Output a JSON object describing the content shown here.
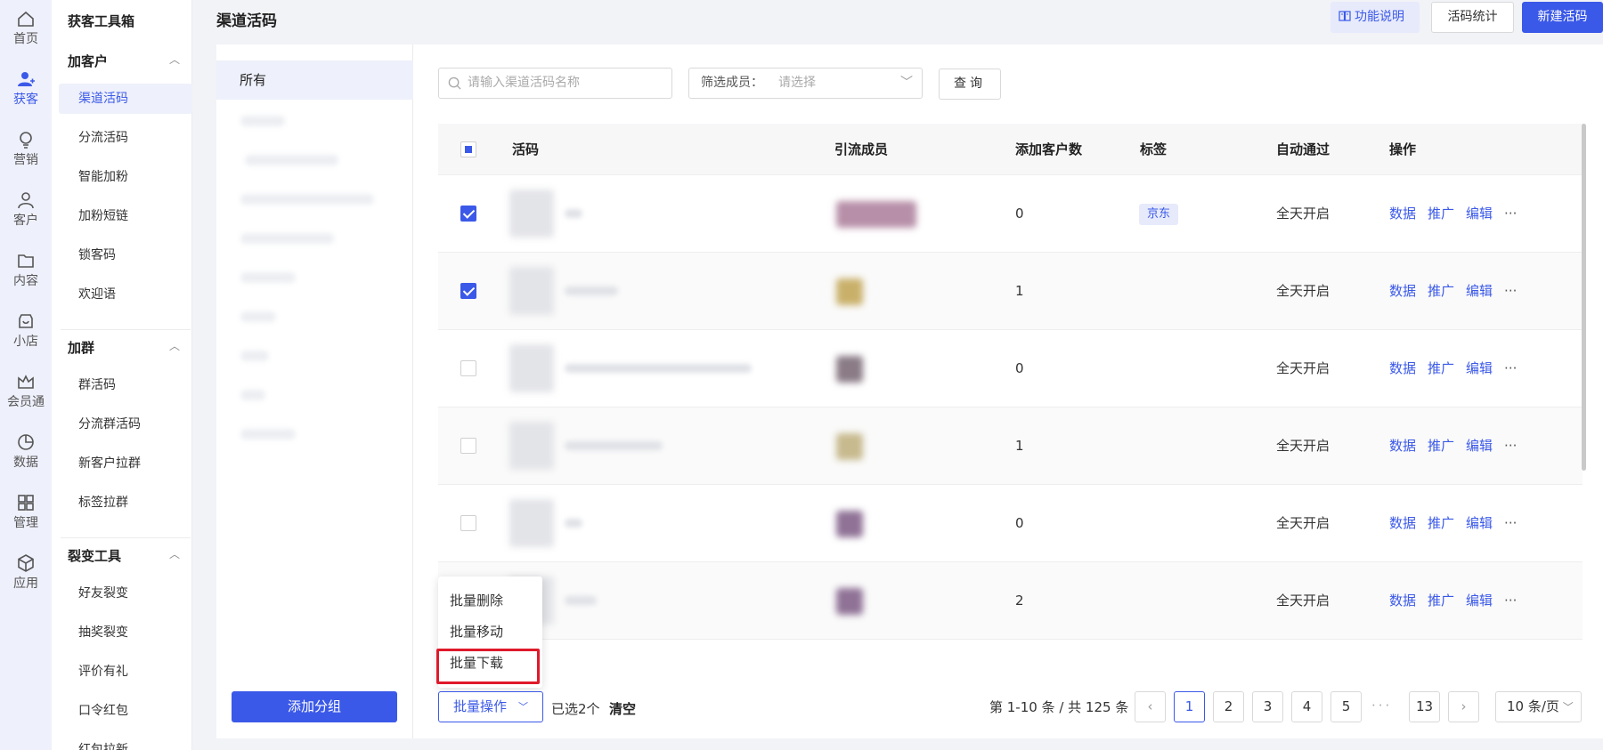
{
  "rail": [
    {
      "label": "首页",
      "icon": "home-icon"
    },
    {
      "label": "获客",
      "icon": "user-plus-icon",
      "active": true
    },
    {
      "label": "营销",
      "icon": "bulb-icon"
    },
    {
      "label": "客户",
      "icon": "user-icon"
    },
    {
      "label": "内容",
      "icon": "folder-icon"
    },
    {
      "label": "小店",
      "icon": "shop-icon"
    },
    {
      "label": "会员通",
      "icon": "crown-icon"
    },
    {
      "label": "数据",
      "icon": "pie-chart-icon"
    },
    {
      "label": "管理",
      "icon": "grid-icon"
    },
    {
      "label": "应用",
      "icon": "cube-icon"
    }
  ],
  "menu": {
    "title": "获客工具箱",
    "groups": [
      {
        "label": "加客户",
        "items": [
          "渠道活码",
          "分流活码",
          "智能加粉",
          "加粉短链",
          "锁客码",
          "欢迎语"
        ]
      },
      {
        "label": "加群",
        "items": [
          "群活码",
          "分流群活码",
          "新客户拉群",
          "标签拉群"
        ]
      },
      {
        "label": "裂变工具",
        "items": [
          "好友裂变",
          "抽奖裂变",
          "评价有礼",
          "口令红包",
          "红包拉新"
        ]
      }
    ],
    "active": "渠道活码"
  },
  "header": {
    "title": "渠道活码",
    "doc_btn": "功能说明",
    "stats_btn": "活码统计",
    "new_btn": "新建活码"
  },
  "groups": {
    "all": "所有",
    "add": "添加分组"
  },
  "search": {
    "placeholder": "请输入渠道活码名称",
    "filter_label": "筛选成员：",
    "filter_placeholder": "请选择",
    "query": "查询"
  },
  "table": {
    "columns": [
      "活码",
      "引流成员",
      "添加客户数",
      "标签",
      "自动通过",
      "操作"
    ],
    "rows": [
      {
        "checked": true,
        "count": "0",
        "tag": "京东",
        "auto": "全天开启"
      },
      {
        "checked": true,
        "count": "1",
        "tag": "",
        "auto": "全天开启"
      },
      {
        "checked": false,
        "count": "0",
        "tag": "",
        "auto": "全天开启"
      },
      {
        "checked": false,
        "count": "1",
        "tag": "",
        "auto": "全天开启"
      },
      {
        "checked": false,
        "count": "0",
        "tag": "",
        "auto": "全天开启"
      },
      {
        "checked": false,
        "count": "2",
        "tag": "",
        "auto": "全天开启"
      }
    ],
    "actions": [
      "数据",
      "推广",
      "编辑"
    ],
    "more": "···"
  },
  "dropdown": [
    "批量删除",
    "批量移动",
    "批量下载"
  ],
  "footer": {
    "bulk": "批量操作",
    "selected": "已选2个",
    "clear": "清空",
    "total": "第 1-10 条 / 共 125 条",
    "pages": [
      "1",
      "2",
      "3",
      "4",
      "5",
      "13"
    ],
    "current_page": "1",
    "dots": "···",
    "page_size": "10 条/页"
  },
  "colors": {
    "accent": "#3b59e8",
    "highlight": "#e0192b"
  }
}
